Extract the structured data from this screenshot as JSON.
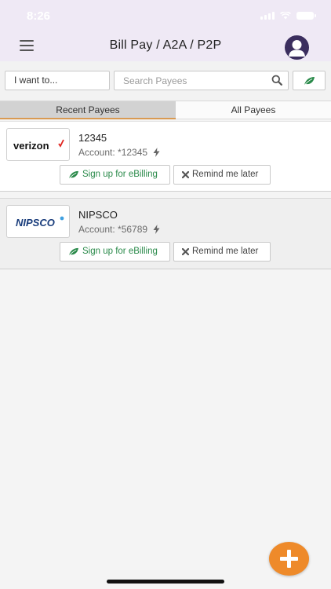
{
  "status_bar": {
    "time": "8:26"
  },
  "header": {
    "title": "Bill Pay / A2A / P2P"
  },
  "filters": {
    "want_label": "I want to...",
    "search_placeholder": "Search Payees",
    "search_value": ""
  },
  "tabs": [
    {
      "label": "Recent Payees",
      "active": true
    },
    {
      "label": "All Payees",
      "active": false
    }
  ],
  "payees": [
    {
      "name": "12345",
      "account": "Account: *12345",
      "logo": "verizon",
      "ebill_label": "Sign up for eBilling",
      "remind_label": "Remind me later"
    },
    {
      "name": "NIPSCO",
      "account": "Account: *56789",
      "logo": "NIPSCO",
      "ebill_label": "Sign up for eBilling",
      "remind_label": "Remind me later"
    }
  ],
  "colors": {
    "header_bg": "#efe9f5",
    "accent_orange": "#ee8a2a",
    "ebill_green": "#2a8a4a",
    "tab_underline": "#d99a52",
    "avatar": "#3b2e5e"
  },
  "icons": [
    "menu-icon",
    "avatar-icon",
    "search-icon",
    "leaf-icon",
    "bolt-icon",
    "close-icon",
    "plus-icon"
  ]
}
